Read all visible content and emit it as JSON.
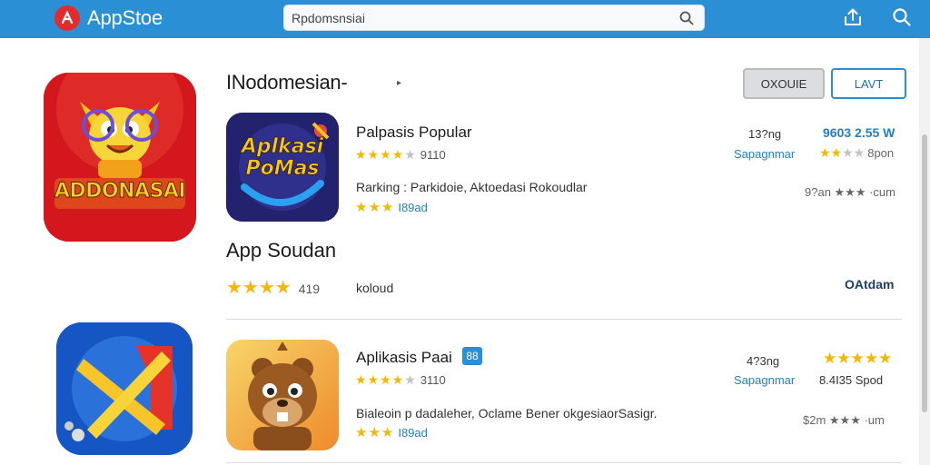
{
  "header": {
    "logo_text": "AppStoe",
    "search_value": "Rpdomsnsiai",
    "icons": [
      "logo-mark-icon",
      "search-icon",
      "share-icon",
      "search-icon"
    ]
  },
  "featured": {
    "top_icon_text": "ADDONASAI",
    "bottom_icon_name": "x-slash-app-icon"
  },
  "section": {
    "title": "INodomesian-",
    "arrow": "▸",
    "btn_grey": "OXOUIE",
    "btn_blue": "LAVT"
  },
  "apps": [
    {
      "icon_text": "Aplkasi PoMas",
      "name": "Palpasis Popular",
      "stars_text": "★★★★",
      "stars_off": "★",
      "meta": "9110",
      "desc": "Rarking : Parkidoie, Aktoedasi Rokoudlar",
      "stars2": "★★★",
      "meta2": "I89ad",
      "right_top": "13?ng",
      "right_price": "9603 2.55 W",
      "right_mid": "Sapagnmar",
      "right_stars": "★★",
      "right_stars_off": "★★",
      "right_mid_tail": "8pon",
      "right_bottom": "9?an ★★★ ·cum"
    },
    {
      "icon_text": "beaver",
      "name": "Aplikasis Paai",
      "badge": "88",
      "stars_text": "★★★★",
      "stars_off": "★",
      "meta": "3110",
      "desc": "Bialeoin p dadaleher, Oclame Bener okgesiaorSasigr.",
      "stars2": "★★★",
      "meta2": "I89ad",
      "right_top": "4?3ng",
      "right_stars_top": "★★★★★",
      "right_mid": "Sapagnmar",
      "right_mid_tail": "8.4I35 Spod",
      "right_bottom": "$2m ★★★ ·um"
    }
  ],
  "sub": {
    "title": "App Soudan",
    "stars": "★★★★",
    "rating": "419",
    "label": "koloud",
    "right": "OAtdam"
  },
  "colors": {
    "header_bg": "#2b8fd6",
    "accent_blue": "#1f7fce",
    "star": "#f5b800",
    "icon_red": "#d4161d"
  }
}
